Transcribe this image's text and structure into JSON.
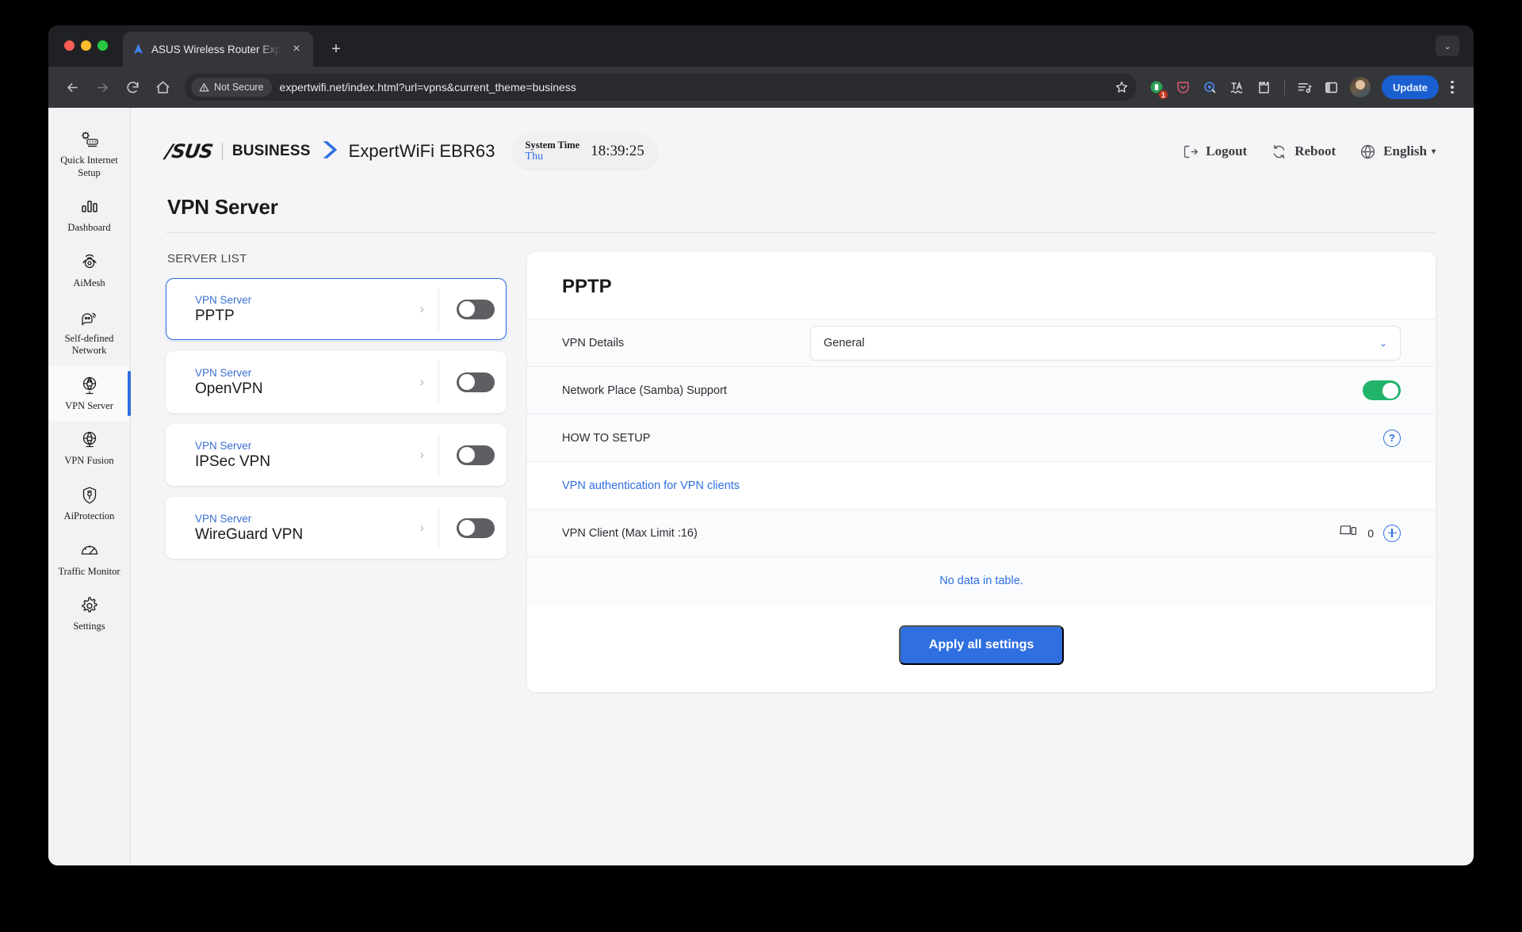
{
  "browser": {
    "tab": {
      "title": "ASUS Wireless Router Exper",
      "favicon": "asus-router-favicon",
      "close_label": "×"
    },
    "new_tab_label": "+",
    "tabstrip_caret": "⌄",
    "omnibox": {
      "security_label": "Not Secure",
      "url": "expertwifi.net/index.html?url=vpns&current_theme=business"
    },
    "extensions": [
      {
        "name": "green-extension-icon",
        "badge": "1"
      },
      {
        "name": "pocket-shield-icon",
        "badge": ""
      },
      {
        "name": "privacy-circle-icon",
        "badge": ""
      },
      {
        "name": "languagetool-icon",
        "badge": ""
      },
      {
        "name": "extensions-puzzle-icon",
        "badge": ""
      }
    ],
    "update_label": "Update"
  },
  "sidebar": {
    "items": [
      {
        "label": "Quick Internet Setup",
        "icon": "quick-internet-setup-icon",
        "active": false
      },
      {
        "label": "Dashboard",
        "icon": "dashboard-icon",
        "active": false
      },
      {
        "label": "AiMesh",
        "icon": "aimesh-icon",
        "active": false
      },
      {
        "label": "Self-defined Network",
        "icon": "self-defined-network-icon",
        "active": false
      },
      {
        "label": "VPN Server",
        "icon": "vpn-server-icon",
        "active": true
      },
      {
        "label": "VPN Fusion",
        "icon": "vpn-fusion-icon",
        "active": false
      },
      {
        "label": "AiProtection",
        "icon": "aiprotection-icon",
        "active": false
      },
      {
        "label": "Traffic Monitor",
        "icon": "traffic-monitor-icon",
        "active": false
      },
      {
        "label": "Settings",
        "icon": "settings-gear-icon",
        "active": false
      }
    ]
  },
  "router_header": {
    "brand": "/SUS",
    "business": "BUSINESS",
    "model": "ExpertWiFi EBR63",
    "system_time_title": "System Time",
    "system_time_day": "Thu",
    "system_time_clock": "18:39:25",
    "logout_label": "Logout",
    "reboot_label": "Reboot",
    "language_label": "English",
    "language_caret": "▾"
  },
  "page": {
    "title": "VPN Server"
  },
  "server_list": {
    "heading": "SERVER LIST",
    "items": [
      {
        "kicker": "VPN Server",
        "name": "PPTP",
        "enabled": false,
        "selected": true
      },
      {
        "kicker": "VPN Server",
        "name": "OpenVPN",
        "enabled": false,
        "selected": false
      },
      {
        "kicker": "VPN Server",
        "name": "IPSec VPN",
        "enabled": false,
        "selected": false
      },
      {
        "kicker": "VPN Server",
        "name": "WireGuard VPN",
        "enabled": false,
        "selected": false
      }
    ],
    "chevron": "›"
  },
  "detail": {
    "title": "PPTP",
    "vpn_details_label": "VPN Details",
    "vpn_details_value": "General",
    "vpn_details_caret": "⌄",
    "samba_label": "Network Place (Samba) Support",
    "samba_enabled": true,
    "how_to_setup_label": "HOW TO SETUP",
    "help_glyph": "?",
    "auth_link_label": "VPN authentication for VPN clients",
    "vpn_client_label": "VPN Client (Max Limit :16)",
    "vpn_client_count": "0",
    "no_data_label": "No data in table.",
    "apply_label": "Apply all settings"
  },
  "colors": {
    "accent": "#2f6fe0",
    "toggle_on": "#22b36b",
    "toggle_off": "#5e5e63",
    "page_bg": "#f5f5f7"
  }
}
